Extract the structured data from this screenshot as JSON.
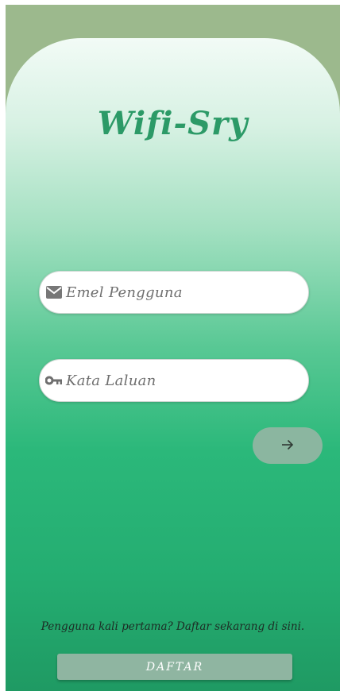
{
  "app": {
    "logo_text": "Wifi-Sry"
  },
  "login": {
    "email_placeholder": "Emel Pengguna",
    "email_icon": "mail-icon",
    "password_placeholder": "Kata Laluan",
    "password_icon": "key-icon",
    "next_icon": "arrow-right-icon"
  },
  "register": {
    "hint_text": "Pengguna kali pertama? Daftar sekarang di sini.",
    "button_label": "DAFTAR"
  },
  "colors": {
    "brand_green": "#2c9a67",
    "top_band": "#9cb98d",
    "button_muted": "#8fb5a1"
  }
}
